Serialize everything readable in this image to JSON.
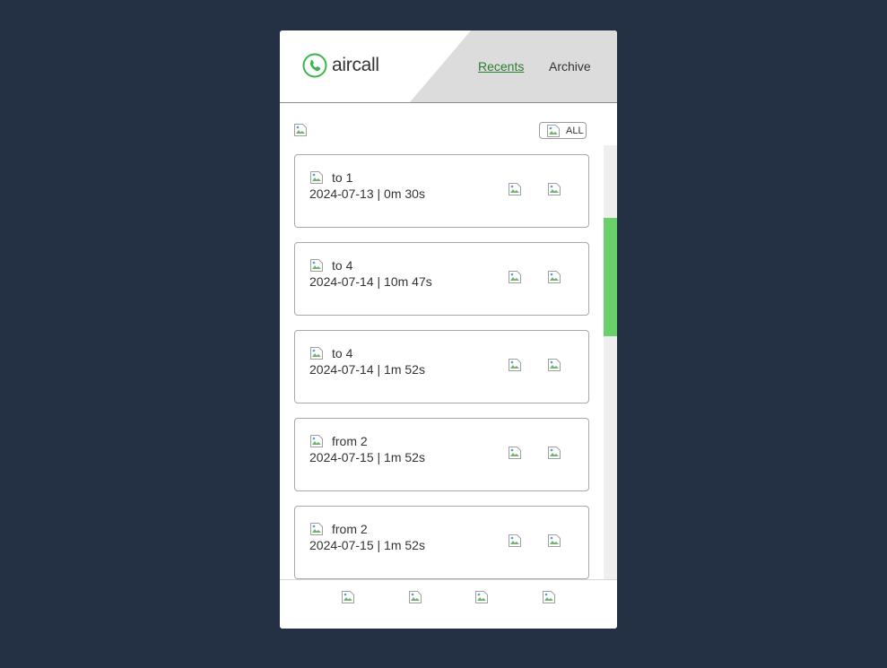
{
  "app": {
    "logo_text": "aircall",
    "brand_color": "#3ab54a"
  },
  "nav": {
    "recents_label": "Recents",
    "archive_label": "Archive",
    "active": "Recents"
  },
  "toolbar": {
    "filter_icon": "broken-image-icon",
    "all_label": "ALL"
  },
  "calls": [
    {
      "direction_label": "to 1",
      "meta": "2024-07-13 | 0m 30s"
    },
    {
      "direction_label": "to 4",
      "meta": "2024-07-14 | 10m 47s"
    },
    {
      "direction_label": "to 4",
      "meta": "2024-07-14 | 1m 52s"
    },
    {
      "direction_label": "from 2",
      "meta": "2024-07-15 | 1m 52s"
    },
    {
      "direction_label": "from 2",
      "meta": "2024-07-15 | 1m 52s"
    }
  ],
  "footer": {
    "buttons": [
      "broken-image-icon",
      "broken-image-icon",
      "broken-image-icon",
      "broken-image-icon"
    ]
  }
}
